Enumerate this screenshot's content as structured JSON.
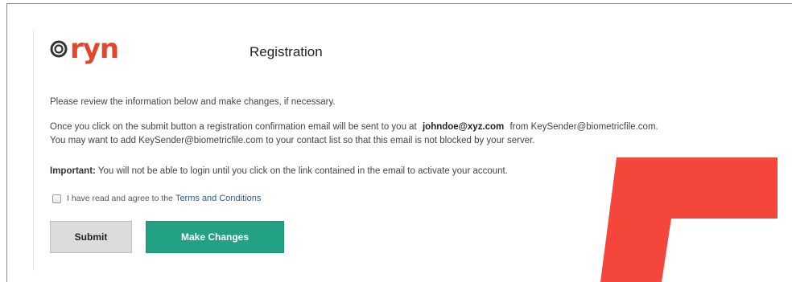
{
  "brand": {
    "logo_text": "ryn",
    "accent_color": "#e2472b"
  },
  "page": {
    "title": "Registration"
  },
  "content": {
    "intro": "Please review the information below and make changes, if necessary.",
    "confirm_line1_before": "Once you click on the submit button a registration confirmation email will be sent to you at",
    "email": "johndoe@xyz.com",
    "confirm_line1_after": "from KeySender@biometricfile.com.",
    "confirm_line2": "You may want to add KeySender@biometricfile.com to your contact list so that this email is not blocked by your server.",
    "important_label": "Important:",
    "important_text": "You will not be able to login until you click on the link contained in the email to activate your account."
  },
  "agreement": {
    "label": "I have read and agree to the",
    "link_text": "Terms and Conditions",
    "checked": false
  },
  "actions": {
    "submit_label": "Submit",
    "make_changes_label": "Make Changes",
    "make_changes_color": "#23a184"
  },
  "overlay": {
    "glyph_color": "#f4463a",
    "glyph": "5"
  }
}
